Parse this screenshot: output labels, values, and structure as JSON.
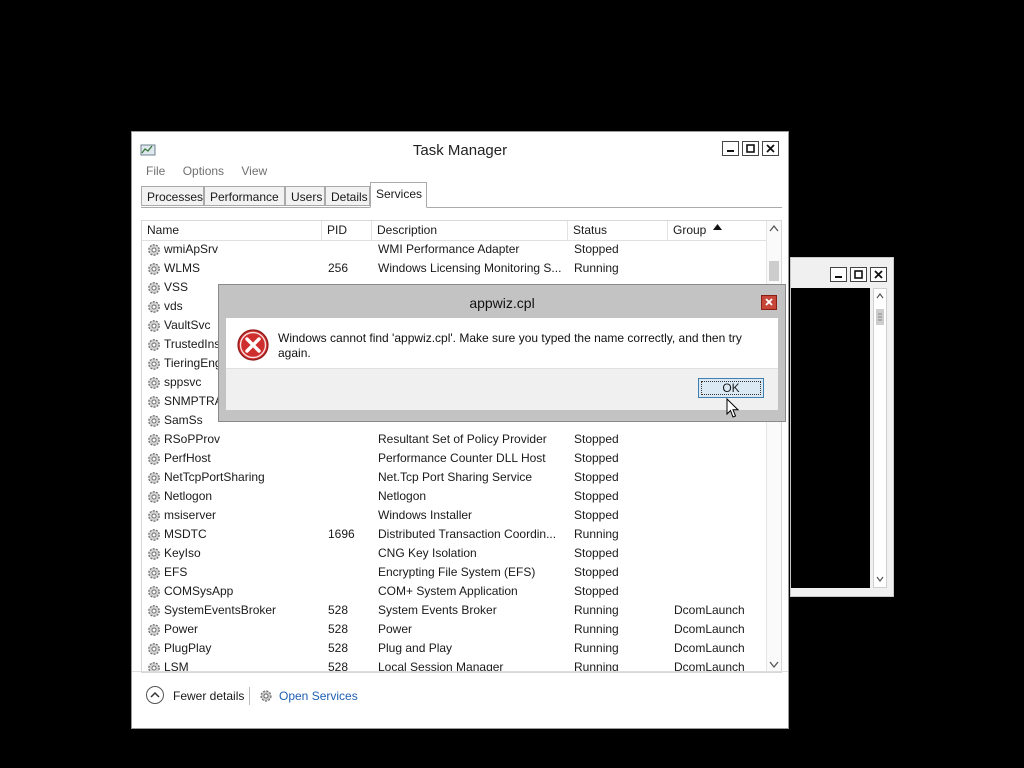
{
  "task_manager": {
    "title": "Task Manager",
    "menu": [
      "File",
      "Options",
      "View"
    ],
    "tabs": [
      {
        "label": "Processes",
        "active": false
      },
      {
        "label": "Performance",
        "active": false
      },
      {
        "label": "Users",
        "active": false
      },
      {
        "label": "Details",
        "active": false
      },
      {
        "label": "Services",
        "active": true
      }
    ],
    "columns": [
      "Name",
      "PID",
      "Description",
      "Status",
      "Group"
    ],
    "sorted_column": "Group",
    "rows": [
      {
        "name": "wmiApSrv",
        "pid": "",
        "description": "WMI Performance Adapter",
        "status": "Stopped",
        "group": ""
      },
      {
        "name": "WLMS",
        "pid": "256",
        "description": "Windows Licensing Monitoring S...",
        "status": "Running",
        "group": ""
      },
      {
        "name": "VSS",
        "pid": "",
        "description": "",
        "status": "",
        "group": ""
      },
      {
        "name": "vds",
        "pid": "",
        "description": "",
        "status": "",
        "group": ""
      },
      {
        "name": "VaultSvc",
        "pid": "",
        "description": "",
        "status": "",
        "group": ""
      },
      {
        "name": "TrustedInst",
        "pid": "",
        "description": "",
        "status": "",
        "group": ""
      },
      {
        "name": "TieringEng",
        "pid": "",
        "description": "",
        "status": "",
        "group": ""
      },
      {
        "name": "sppsvc",
        "pid": "",
        "description": "",
        "status": "",
        "group": ""
      },
      {
        "name": "SNMPTRAP",
        "pid": "",
        "description": "",
        "status": "",
        "group": ""
      },
      {
        "name": "SamSs",
        "pid": "",
        "description": "",
        "status": "",
        "group": ""
      },
      {
        "name": "RSoPProv",
        "pid": "",
        "description": "Resultant Set of Policy Provider",
        "status": "Stopped",
        "group": ""
      },
      {
        "name": "PerfHost",
        "pid": "",
        "description": "Performance Counter DLL Host",
        "status": "Stopped",
        "group": ""
      },
      {
        "name": "NetTcpPortSharing",
        "pid": "",
        "description": "Net.Tcp Port Sharing Service",
        "status": "Stopped",
        "group": ""
      },
      {
        "name": "Netlogon",
        "pid": "",
        "description": "Netlogon",
        "status": "Stopped",
        "group": ""
      },
      {
        "name": "msiserver",
        "pid": "",
        "description": "Windows Installer",
        "status": "Stopped",
        "group": ""
      },
      {
        "name": "MSDTC",
        "pid": "1696",
        "description": "Distributed Transaction Coordin...",
        "status": "Running",
        "group": ""
      },
      {
        "name": "KeyIso",
        "pid": "",
        "description": "CNG Key Isolation",
        "status": "Stopped",
        "group": ""
      },
      {
        "name": "EFS",
        "pid": "",
        "description": "Encrypting File System (EFS)",
        "status": "Stopped",
        "group": ""
      },
      {
        "name": "COMSysApp",
        "pid": "",
        "description": "COM+ System Application",
        "status": "Stopped",
        "group": ""
      },
      {
        "name": "SystemEventsBroker",
        "pid": "528",
        "description": "System Events Broker",
        "status": "Running",
        "group": "DcomLaunch"
      },
      {
        "name": "Power",
        "pid": "528",
        "description": "Power",
        "status": "Running",
        "group": "DcomLaunch"
      },
      {
        "name": "PlugPlay",
        "pid": "528",
        "description": "Plug and Play",
        "status": "Running",
        "group": "DcomLaunch"
      },
      {
        "name": "LSM",
        "pid": "528",
        "description": "Local Session Manager",
        "status": "Running",
        "group": "DcomLaunch"
      }
    ],
    "footer": {
      "fewer_details": "Fewer details",
      "open_services": "Open Services"
    }
  },
  "dialog": {
    "title": "appwiz.cpl",
    "message": "Windows cannot find 'appwiz.cpl'. Make sure you typed the name correctly, and then try again.",
    "ok_label": "OK",
    "icon": "error-icon"
  },
  "colors": {
    "link": "#1e5fb3",
    "error_red": "#c7463a",
    "ok_button_bg": "#dbe9f5"
  }
}
